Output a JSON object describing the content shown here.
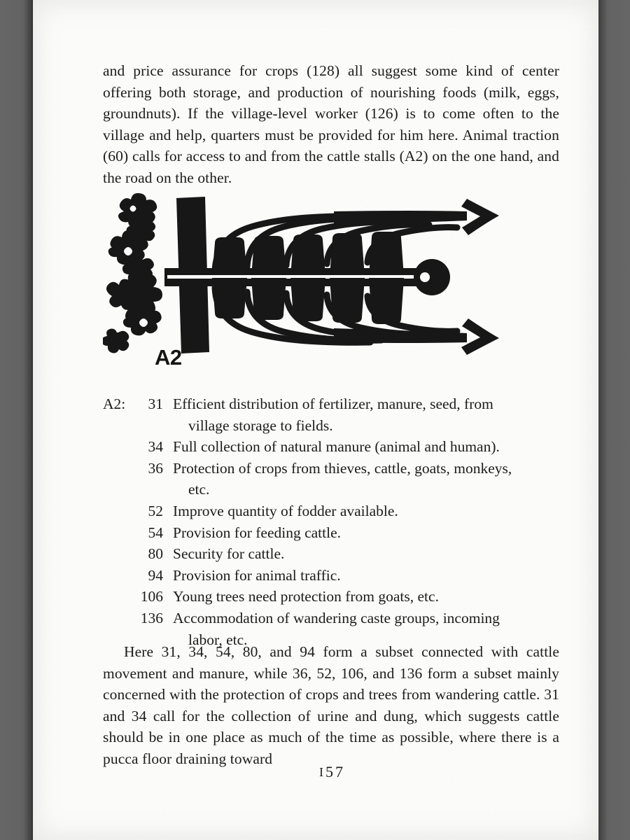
{
  "page": {
    "folio": "157",
    "folio_prefix_glyph": "I",
    "folio_rest": "57"
  },
  "intro_paragraph": {
    "text": "and price assurance for crops (128) all suggest some kind of center offering both storage, and production of nourishing foods (milk, eggs, groundnuts). If the village-level worker (126) is to come often to the village and help, quarters must be provided for him here. Animal traction (60) calls for access to and from the cattle stalls (A2) on the one hand, and the road on the other."
  },
  "figure": {
    "label": "A2",
    "caption_name": "cattle-stalls-pictogram",
    "ink_color": "#171717"
  },
  "pattern_list": {
    "tag": "A2:",
    "items": [
      {
        "number": "31",
        "line1": "Efficient distribution of fertilizer, manure, seed, from",
        "line2": "village storage to fields."
      },
      {
        "number": "34",
        "line1": "Full collection of natural manure (animal and human).",
        "line2": ""
      },
      {
        "number": "36",
        "line1": "Protection of crops from thieves, cattle, goats, monkeys,",
        "line2": "etc."
      },
      {
        "number": "52",
        "line1": "Improve quantity of fodder available.",
        "line2": ""
      },
      {
        "number": "54",
        "line1": "Provision for feeding cattle.",
        "line2": ""
      },
      {
        "number": "80",
        "line1": "Security for cattle.",
        "line2": ""
      },
      {
        "number": "94",
        "line1": "Provision for animal traffic.",
        "line2": ""
      },
      {
        "number": "106",
        "line1": "Young trees need protection from goats, etc.",
        "line2": ""
      },
      {
        "number": "136",
        "line1": "Accommodation of wandering caste groups, incoming",
        "line2": "labor, etc."
      }
    ]
  },
  "closing_paragraph": {
    "text": "Here 31, 34, 54, 80, and 94 form a subset connected with cattle movement and manure, while 36, 52, 106, and 136 form a subset mainly concerned with the protection of crops and trees from wandering cattle. 31 and 34 call for the collection of urine and dung, which suggests cattle should be in one place as much of the time as possible, where there is a pucca floor draining toward"
  },
  "colors": {
    "page_background": "#fbfbfa",
    "surround_gray": "#616161",
    "text": "#1c1c1c"
  }
}
